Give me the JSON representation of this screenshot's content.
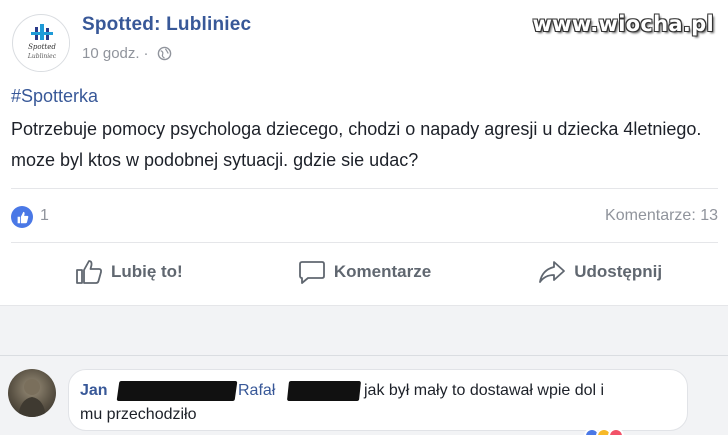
{
  "post": {
    "page_name": "Spotted: Lubliniec",
    "time": "10 godz.",
    "separator": "·",
    "hashtag": "#Spotterka",
    "text": "Potrzebuje pomocy psychologa dziecego, chodzi o napady agresji u dziecka 4letniego. moze byl ktos w podobnej sytuacji. gdzie sie udac?",
    "likes_count": "1",
    "comments_count": "Komentarze: 13"
  },
  "actions": {
    "like_label": "Lubię to!",
    "comment_label": "Komentarze",
    "share_label": "Udostępnij"
  },
  "watermark": "www.wiocha.pl",
  "comment": {
    "author_visible": "Jan",
    "mention_visible": "Rafał",
    "text_line1": "jak był mały to dostawał wpie  dol i",
    "text_line2": "mu przechodziło"
  },
  "colors": {
    "link_blue": "#385898",
    "like_blue": "#4a78e6",
    "meta_gray": "#90949c",
    "action_gray": "#606770",
    "background_gray": "#f2f3f5"
  }
}
